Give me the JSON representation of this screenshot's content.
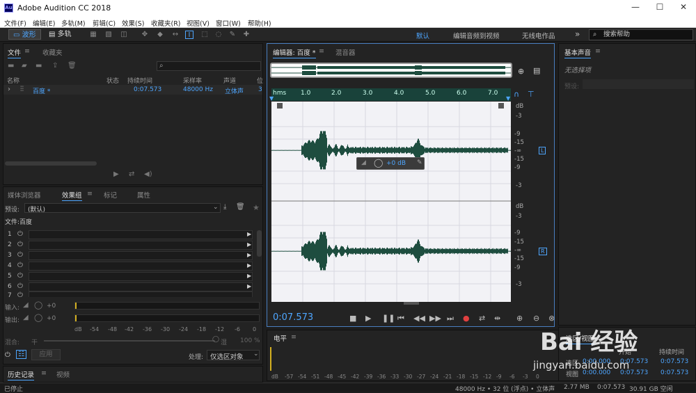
{
  "window": {
    "title": "Adobe Audition CC 2018",
    "logo": "Au",
    "controls": {
      "minimize": "—",
      "maximize": "☐",
      "close": "✕"
    }
  },
  "menu": [
    "文件(F)",
    "编辑(E)",
    "多轨(M)",
    "剪辑(C)",
    "效果(S)",
    "收藏夹(R)",
    "视图(V)",
    "窗口(W)",
    "帮助(H)"
  ],
  "toolbar": {
    "waveform": "波形",
    "multitrack": "多轨",
    "workspaces": [
      "默认",
      "编辑音频到视频",
      "无线电作品"
    ],
    "more": "»",
    "search_placeholder": "搜索帮助"
  },
  "files_panel": {
    "tabs": [
      "文件",
      "收藏夹"
    ],
    "columns": [
      "名称",
      "状态",
      "持续时间",
      "采样率",
      "声道",
      "位"
    ],
    "row": {
      "name": "百度 *",
      "duration": "0:07.573",
      "sample_rate": "48000 Hz",
      "channels": "立体声",
      "bits": "3"
    }
  },
  "effects_panel": {
    "tabs": [
      "媒体浏览器",
      "效果组",
      "标记",
      "属性"
    ],
    "preset_label": "预设:",
    "preset_value": "(默认)",
    "file_label": "文件:百度",
    "slots": [
      "1",
      "2",
      "3",
      "4",
      "5",
      "6",
      "7"
    ],
    "input_label": "输入:",
    "input_db": "+0",
    "output_label": "输出:",
    "output_db": "+0",
    "mix_label": "混合:",
    "mix_scale": [
      "干",
      "湿",
      "100 %"
    ],
    "meter_scale": [
      "dB",
      "-54",
      "-48",
      "-42",
      "-36",
      "-30",
      "-24",
      "-18",
      "-12",
      "-6",
      "0"
    ],
    "apply": "应用",
    "process_label": "处理:",
    "process_value": "仅选区对象"
  },
  "history_panel": {
    "tabs": [
      "历史记录",
      "视频"
    ],
    "status": "已停止"
  },
  "editor": {
    "tabs": [
      "编辑器: 百度 *",
      "混音器"
    ],
    "ruler": [
      "hms",
      "1.0",
      "2.0",
      "3.0",
      "4.0",
      "5.0",
      "6.0",
      "7.0"
    ],
    "db_top": [
      "dB",
      "-3",
      "-9",
      "-15",
      "-∞",
      "-15",
      "-9",
      "-3"
    ],
    "db_bottom": [
      "dB",
      "-3",
      "-9",
      "-15",
      "-∞",
      "-15",
      "-9",
      "-3"
    ],
    "ch_left": "L",
    "ch_right": "R",
    "hud_value": "+0 dB",
    "time": "0:07.573"
  },
  "levels_panel": {
    "title": "电平",
    "scale": [
      "dB",
      "-57",
      "-54",
      "-51",
      "-48",
      "-45",
      "-42",
      "-39",
      "-36",
      "-33",
      "-30",
      "-27",
      "-24",
      "-21",
      "-18",
      "-15",
      "-12",
      "-9",
      "-6",
      "-3",
      "0"
    ]
  },
  "essential_sound": {
    "title": "基本声音",
    "no_selection": "无选择项",
    "preset_label": "预设:"
  },
  "selection_panel": {
    "tab": "选区/视图",
    "headers": [
      "开始",
      "持续时间"
    ],
    "rows": [
      {
        "label": "选区",
        "start": "0:00.000",
        "end": "0:07.573",
        "dur": "0:07.573"
      },
      {
        "label": "视图",
        "start": "0:00.000",
        "end": "0:07.573",
        "dur": "0:07.573"
      }
    ]
  },
  "status_bar": {
    "format": "48000 Hz • 32 位 (浮点) • 立体声",
    "size": "2.77 MB",
    "duration": "0:07.573",
    "free": "30.91 GB 空闲"
  },
  "watermark": {
    "brand": "Bai 经验",
    "url": "jingyan.baidu.com"
  },
  "colors": {
    "accent": "#4ea6ff",
    "waveform": "#1e4d3f",
    "ruler": "#19423a",
    "record": "#e04040"
  }
}
